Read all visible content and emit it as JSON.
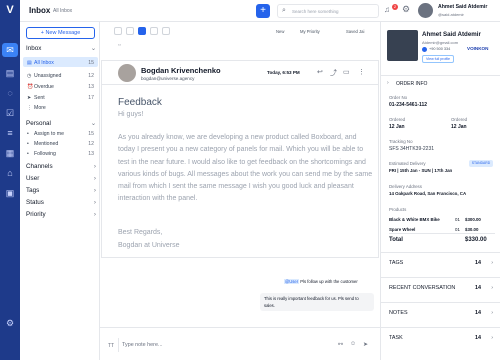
{
  "app": {
    "title": "Inbox",
    "subtitle": "All Inbox"
  },
  "search": {
    "placeholder": "Search here something"
  },
  "notif_count": "2",
  "user": {
    "name": "Ahmet Said Atdemir",
    "email": "@said.atdemir"
  },
  "sidebar": {
    "new_message": "+ New Message",
    "inbox_label": "Inbox",
    "inbox_items": [
      {
        "label": "All Inbox",
        "count": "15"
      },
      {
        "label": "Unassigned",
        "count": "12"
      },
      {
        "label": "Overdue",
        "count": "13"
      },
      {
        "label": "Sent",
        "count": "17"
      },
      {
        "label": "More",
        "count": ""
      }
    ],
    "personal_label": "Personal",
    "personal_items": [
      {
        "label": "Assign to me",
        "count": "15"
      },
      {
        "label": "Mentioned",
        "count": "12"
      },
      {
        "label": "Following",
        "count": "13"
      }
    ],
    "sections": [
      "Channels",
      "User",
      "Tags",
      "Status",
      "Priority"
    ]
  },
  "toolbar": {
    "filter1": "New",
    "filter2": "My Priority",
    "filter3": "Saved Jai"
  },
  "email": {
    "from_name": "Bogdan Krivenchenko",
    "from_email": "bogdan@universe.agency",
    "time": "Today, 6:53 PM",
    "subject": "Feedback",
    "greeting": "Hi guys!",
    "body": "As you already know, we are developing a new product called Boxboard, and today I present you a new category of panels for mail. Which you will be able to test in the near future. I would also like to get feedback on the shortcomings and various kinds of bugs. All messages about the work you can send me by the same mail from which I sent the same message I wish you good luck and pleasant interaction with the panel.",
    "sign1": "Best Regards,",
    "sign2": "Bogdan at Universe"
  },
  "chat": {
    "mention": "@User",
    "msg1": " Pls follow up with the customer",
    "msg2": "This is really important feedback for us. Pls send to sales."
  },
  "compose": {
    "prefix": "TT",
    "placeholder": "Type note here..."
  },
  "customer": {
    "name": "Ahmet Said Atdemir",
    "email": "Atdemir@gmail.com",
    "phone": "+90 500 334",
    "brand": "VOINKON",
    "profile_btn": "View full profile"
  },
  "order": {
    "title": "ORDER INFO",
    "order_no_label": "Order No",
    "order_no": "01-234-5461-112",
    "ordered_label": "Ordered",
    "ordered": "12 Jan",
    "ordered2_label": "Ordered",
    "ordered2": "12 Jan",
    "tracking_label": "Tracking No",
    "tracking": "SFS 34HTK39-2231",
    "est_label": "Estimated Delivery",
    "est_badge": "STANDARD",
    "est": "FRI | 15th Jan - SUN | 17th Jan",
    "addr_label": "Delivery Address",
    "addr": "14 Oakpark Road, San Francisco, CA",
    "products_label": "Products",
    "products": [
      {
        "name": "Black & White BMX Bike",
        "qty": "01",
        "price": "$300.00"
      },
      {
        "name": "Spare Wheel",
        "qty": "01",
        "price": "$30.00"
      }
    ],
    "total_label": "Total",
    "total": "$330.00"
  },
  "sections": [
    {
      "label": "TAGS",
      "count": "14"
    },
    {
      "label": "RECENT CONVERSATION",
      "count": "14"
    },
    {
      "label": "NOTES",
      "count": "14"
    },
    {
      "label": "TASK",
      "count": "14"
    }
  ]
}
